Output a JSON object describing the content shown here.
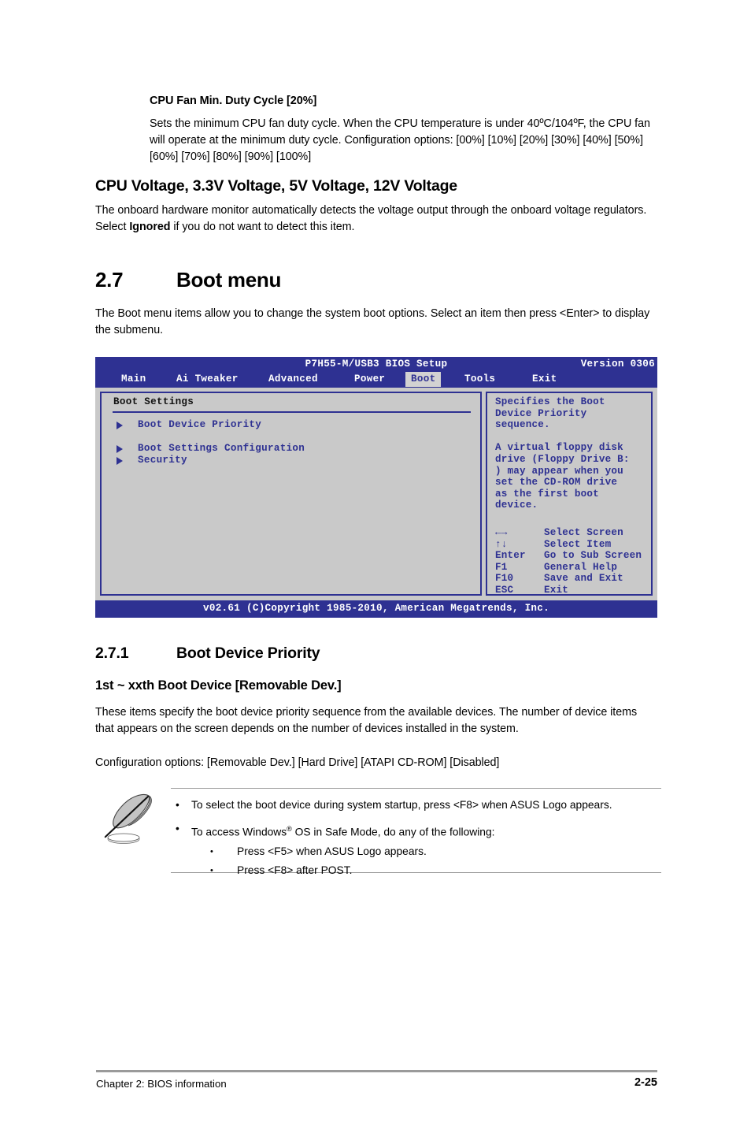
{
  "document": {
    "sections": {
      "cpu_fan": {
        "heading": "CPU Fan Min. Duty Cycle [20%]",
        "body": "Sets the minimum CPU fan duty cycle. When the CPU temperature is under 40ºC/104ºF, the CPU fan will operate at the minimum duty cycle. Configuration options: [00%] [10%] [20%] [30%] [40%] [50%] [60%] [70%] [80%] [90%] [100%]"
      },
      "voltage": {
        "heading": "CPU Voltage, 3.3V Voltage, 5V Voltage, 12V Voltage",
        "body_part1": "The onboard hardware monitor automatically detects the voltage output through the onboard voltage regulators. Select ",
        "body_bold": "Ignored",
        "body_part2": " if you do not want to detect this item."
      },
      "boot_menu": {
        "number": "2.7",
        "title": "Boot menu",
        "body": "The Boot menu items allow you to change the system boot options. Select an item then press <Enter> to display the submenu."
      },
      "boot_device_priority": {
        "number": "2.7.1",
        "title": "Boot Device Priority",
        "subheading": "1st ~ xxth Boot Device [Removable Dev.]",
        "body": "These items specify the boot device priority sequence from the available devices. The number of device items that appears on the screen depends on the number of devices installed in the system.",
        "config_options": "Configuration options: [Removable Dev.] [Hard Drive] [ATAPI CD-ROM] [Disabled]"
      }
    },
    "note": {
      "bullets": [
        "To select the boot device during system startup, press <F8> when ASUS Logo appears."
      ],
      "bullet2_part1": "To access Windows",
      "bullet2_sup": "®",
      "bullet2_part2": " OS in Safe Mode, do any of the following:",
      "sub_bullets": [
        "Press <F5> when ASUS Logo appears.",
        "Press <F8> after POST."
      ],
      "bullet_glyph": "•"
    },
    "footer": {
      "left": "Chapter 2: BIOS information",
      "page": "2-25"
    }
  },
  "bios": {
    "title": "P7H55-M/USB3 BIOS Setup",
    "version": "Version 0306",
    "tabs": [
      {
        "label": "Main",
        "active": false
      },
      {
        "label": "Ai Tweaker",
        "active": false
      },
      {
        "label": "Advanced",
        "active": false
      },
      {
        "label": "Power",
        "active": false
      },
      {
        "label": "Boot",
        "active": true
      },
      {
        "label": "Tools",
        "active": false
      },
      {
        "label": "Exit",
        "active": false
      }
    ],
    "section_title": "Boot Settings",
    "items": [
      {
        "label": "Boot Device Priority"
      },
      {
        "label": "Boot Settings Configuration"
      },
      {
        "label": "Security"
      }
    ],
    "help_text": "Specifies the Boot\nDevice Priority\nsequence.\n\nA virtual floppy disk\ndrive (Floppy Drive B:\n) may appear when you\nset the CD-ROM drive\nas the first boot\ndevice.",
    "keys": [
      {
        "key": "←→",
        "action": "Select Screen"
      },
      {
        "key": "↑↓",
        "action": "Select Item"
      },
      {
        "key": "Enter",
        "action": "Go to Sub Screen"
      },
      {
        "key": "F1",
        "action": "General Help"
      },
      {
        "key": "F10",
        "action": "Save and Exit"
      },
      {
        "key": "ESC",
        "action": "Exit"
      }
    ],
    "copyright": "v02.61 (C)Copyright 1985-2010, American Megatrends, Inc.",
    "colors": {
      "blue": "#2e3192",
      "body_gray": "#c9c9c9",
      "active_tab_bg": "#d2d2d2"
    }
  }
}
